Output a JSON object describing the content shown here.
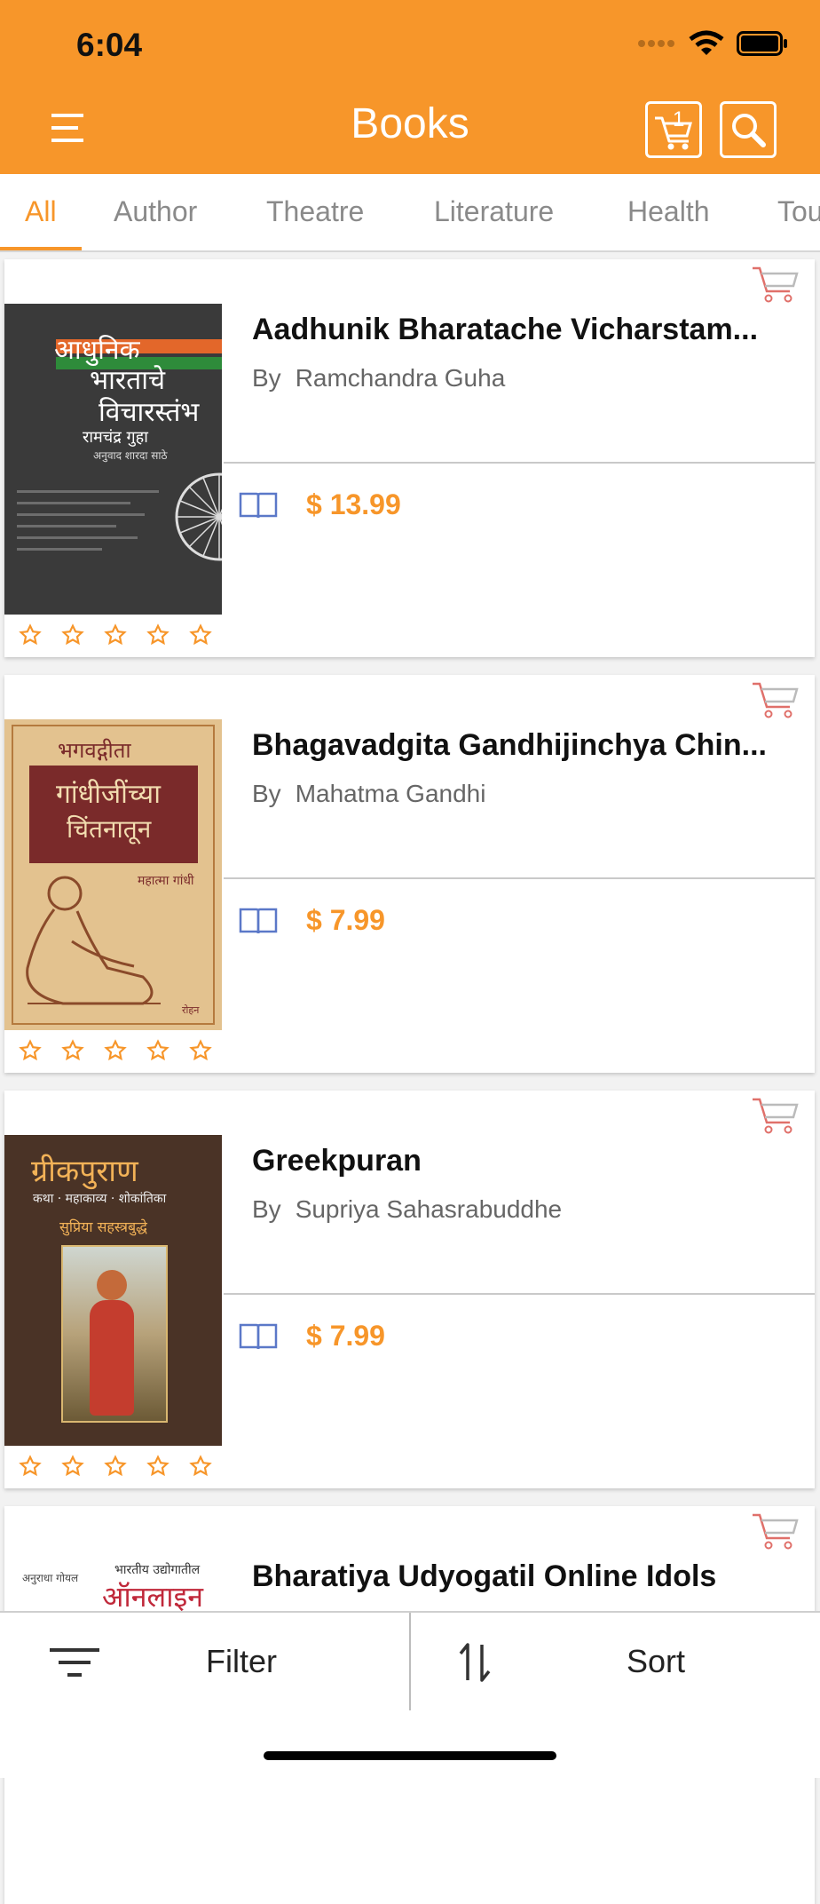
{
  "status": {
    "time": "6:04"
  },
  "header": {
    "title": "Books",
    "cart_count": "1"
  },
  "tabs": [
    "All",
    "Author",
    "Theatre",
    "Literature",
    "Health",
    "Tou"
  ],
  "books": [
    {
      "title": "Aadhunik Bharatache Vicharstam...",
      "by": "By",
      "author": "Ramchandra Guha",
      "price": "$ 13.99",
      "cover_line1": "आधुनिक",
      "cover_line2": "भारताचे",
      "cover_line3": "विचारस्तंभ",
      "cover_author": "रामचंद्र गुहा",
      "cover_sub": "अनुवाद शारदा साठे"
    },
    {
      "title": "Bhagavadgita Gandhijinchya Chin...",
      "by": "By",
      "author": "Mahatma Gandhi",
      "price": "$ 7.99",
      "cover_line1": "भगवद्गीता",
      "cover_line2": "गांधीजींच्या",
      "cover_line3": "चिंतनातून",
      "cover_author": "महात्मा गांधी",
      "cover_sub": "रोहन"
    },
    {
      "title": "Greekpuran",
      "by": "By",
      "author": "Supriya Sahasrabuddhe",
      "price": "$ 7.99",
      "cover_line1": "ग्रीकपुराण",
      "cover_line2": "कथा · महाकाव्य · शोकांतिका",
      "cover_line3": "सुप्रिया सहस्त्रबुद्धे",
      "cover_author": "",
      "cover_sub": ""
    },
    {
      "title": "Bharatiya Udyogatil Online Idols",
      "by": "",
      "author": "",
      "price": "",
      "cover_line1": "भारतीय उद्योगातील",
      "cover_line2": "ऑनलाइन",
      "cover_line3": "अनुराधा गोयल",
      "cover_author": "",
      "cover_sub": ""
    }
  ],
  "bottom": {
    "filter_label": "Filter",
    "sort_label": "Sort"
  },
  "colors": {
    "accent": "#F7962A",
    "sample_icon": "#5B78C8",
    "cart_icon": "#E0706A"
  }
}
